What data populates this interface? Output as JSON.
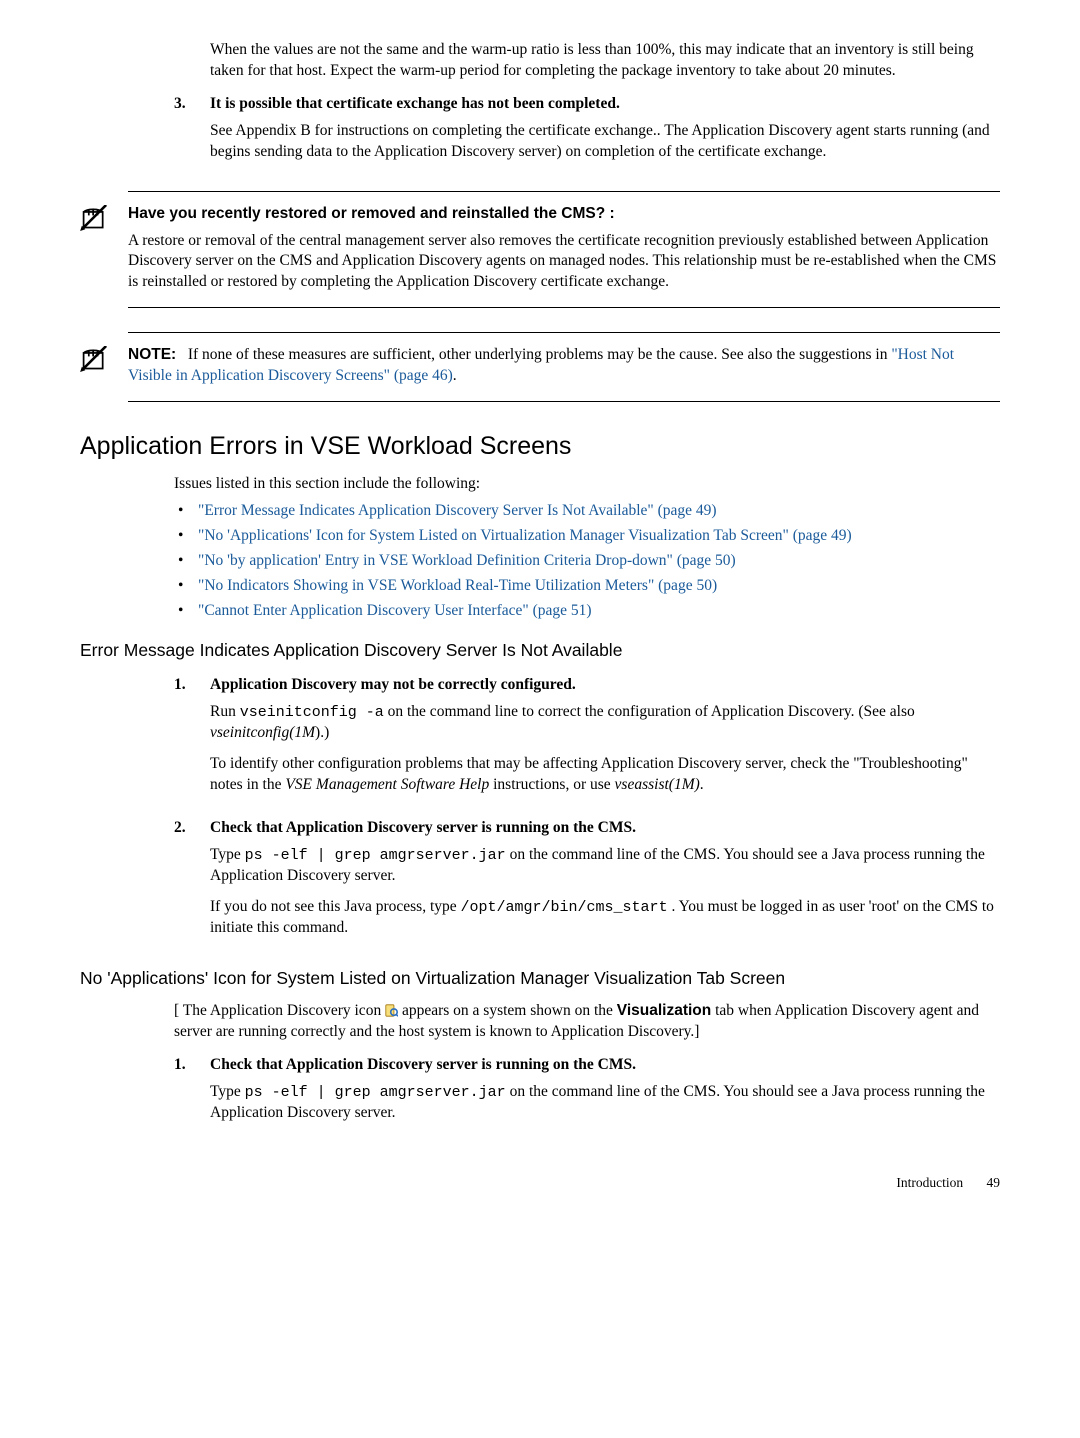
{
  "top_paragraph": "When the values are not the same and the warm-up ratio is less than 100%, this may indicate that an inventory is still being taken for that host. Expect the warm-up period for completing the package inventory to take about 20 minutes.",
  "step3": {
    "num": "3.",
    "title": "It is possible that certificate exchange has not been completed.",
    "body": "See Appendix B for instructions on completing the certificate exchange.. The Application Discovery agent starts running (and begins sending data to the Application Discovery server) on completion of the certificate exchange."
  },
  "note1": {
    "title": "Have you recently restored or removed and reinstalled the CMS? :",
    "body": "A restore or removal of the central management server also removes the certificate recognition previously established between Application Discovery server on the CMS and Application Discovery agents on managed nodes. This relationship must be re-established when the CMS is reinstalled or restored by completing the Application Discovery certificate exchange."
  },
  "note2": {
    "prefix": "NOTE:",
    "lead": "If none of these measures are sufficient, other underlying problems may be the cause. See also the suggestions in ",
    "link_text": "\"Host Not Visible in Application Discovery Screens\" (page 46)",
    "tail": "."
  },
  "section_title": "Application Errors in VSE Workload Screens",
  "section_intro": "Issues listed in this section include the following:",
  "bullets": [
    "\"Error Message Indicates Application Discovery Server Is Not Available\" (page 49)",
    "\"No 'Applications' Icon for System Listed on Virtualization Manager Visualization Tab Screen\" (page 49)",
    "\"No 'by application' Entry in VSE Workload Definition Criteria Drop-down\" (page 50)",
    "\"No Indicators Showing in VSE Workload Real-Time Utilization Meters\" (page 50)",
    "\"Cannot Enter Application Discovery User Interface\" (page 51)"
  ],
  "subA": {
    "title": "Error Message Indicates Application Discovery Server Is Not Available",
    "step1": {
      "num": "1.",
      "title": "Application Discovery may not be correctly configured.",
      "p1a": "Run ",
      "cmd1": "vseinitconfig -a",
      "p1b": " on the command line to correct the configuration of Application Discovery. (See also ",
      "em1": "vseinitconfig(1M",
      "p1c": ").)",
      "p2a": "To identify other configuration problems that may be affecting Application Discovery server, check the \"Troubleshooting\" notes in the ",
      "em2": "VSE Management Software Help",
      "p2b": " instructions, or use ",
      "em3": "vseassist(1M)",
      "p2c": "."
    },
    "step2": {
      "num": "2.",
      "title": "Check that Application Discovery server is running on the CMS.",
      "p1a": "Type ",
      "cmd1": "ps -elf | grep amgrserver.jar",
      "p1b": " on the command line of the CMS. You should see a Java process running the Application Discovery server.",
      "p2a": "If you do not see this Java process, type ",
      "cmd2": "/opt/amgr/bin/cms_start",
      "p2b": " . You must be logged in as user 'root' on the CMS to initiate this command."
    }
  },
  "subB": {
    "title": "No 'Applications' Icon for System Listed on Virtualization Manager Visualization Tab Screen",
    "lead_a": "[ The Application Discovery icon ",
    "lead_b": " appears on a system shown on the ",
    "lead_strong": "Visualization",
    "lead_c": " tab when Application Discovery agent and server are running correctly and the host system is known to Application Discovery.]",
    "step1": {
      "num": "1.",
      "title": "Check that Application Discovery server is running on the CMS.",
      "p1a": "Type ",
      "cmd1": "ps -elf | grep amgrserver.jar",
      "p1b": " on the command line of the CMS. You should see a Java process running the Application Discovery server."
    }
  },
  "footer": {
    "label": "Introduction",
    "page": "49"
  }
}
